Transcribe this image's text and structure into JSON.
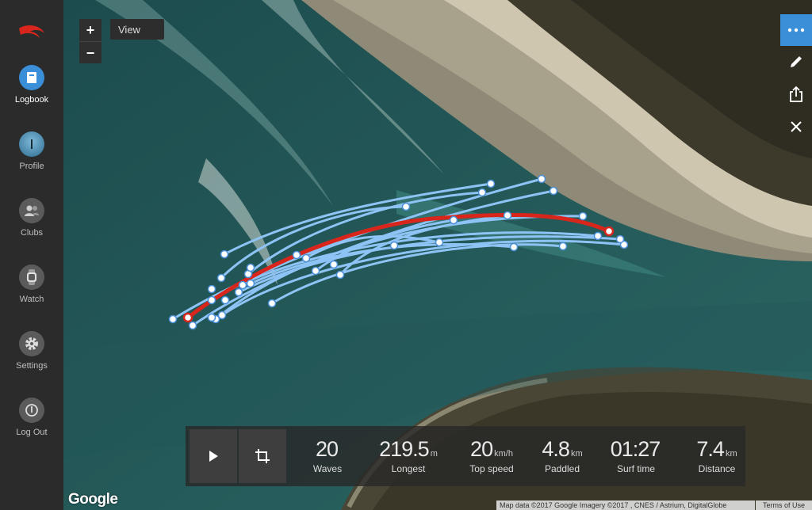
{
  "sidebar": {
    "items": [
      {
        "label": "Logbook",
        "icon": "book-icon"
      },
      {
        "label": "Profile",
        "icon": "avatar-icon"
      },
      {
        "label": "Clubs",
        "icon": "people-icon"
      },
      {
        "label": "Watch",
        "icon": "watch-icon"
      },
      {
        "label": "Settings",
        "icon": "gear-icon"
      },
      {
        "label": "Log Out",
        "icon": "power-icon"
      }
    ],
    "active": "Logbook"
  },
  "map": {
    "zoom_in": "+",
    "zoom_out": "−",
    "view_label": "View",
    "google_label": "Google",
    "attribution": "Map data ©2017 Google Imagery ©2017 , CNES / Astrium, DigitalGlobe",
    "terms": "Terms of Use"
  },
  "toolbar": {
    "icons": [
      "more-icon",
      "pencil-icon",
      "share-icon",
      "close-icon"
    ]
  },
  "stats": [
    {
      "value": "20",
      "unit": "",
      "label": "Waves"
    },
    {
      "value": "219.5",
      "unit": "m",
      "label": "Longest"
    },
    {
      "value": "20",
      "unit": "km/h",
      "label": "Top speed"
    },
    {
      "value": "4.8",
      "unit": "km",
      "label": "Paddled"
    },
    {
      "value": "01:27",
      "unit": "",
      "label": "Surf time"
    },
    {
      "value": "7.4",
      "unit": "km",
      "label": "Distance"
    }
  ],
  "colors": {
    "accent": "#3b8fd8",
    "track": "#8ec3f5",
    "highlight": "#d9261c"
  }
}
